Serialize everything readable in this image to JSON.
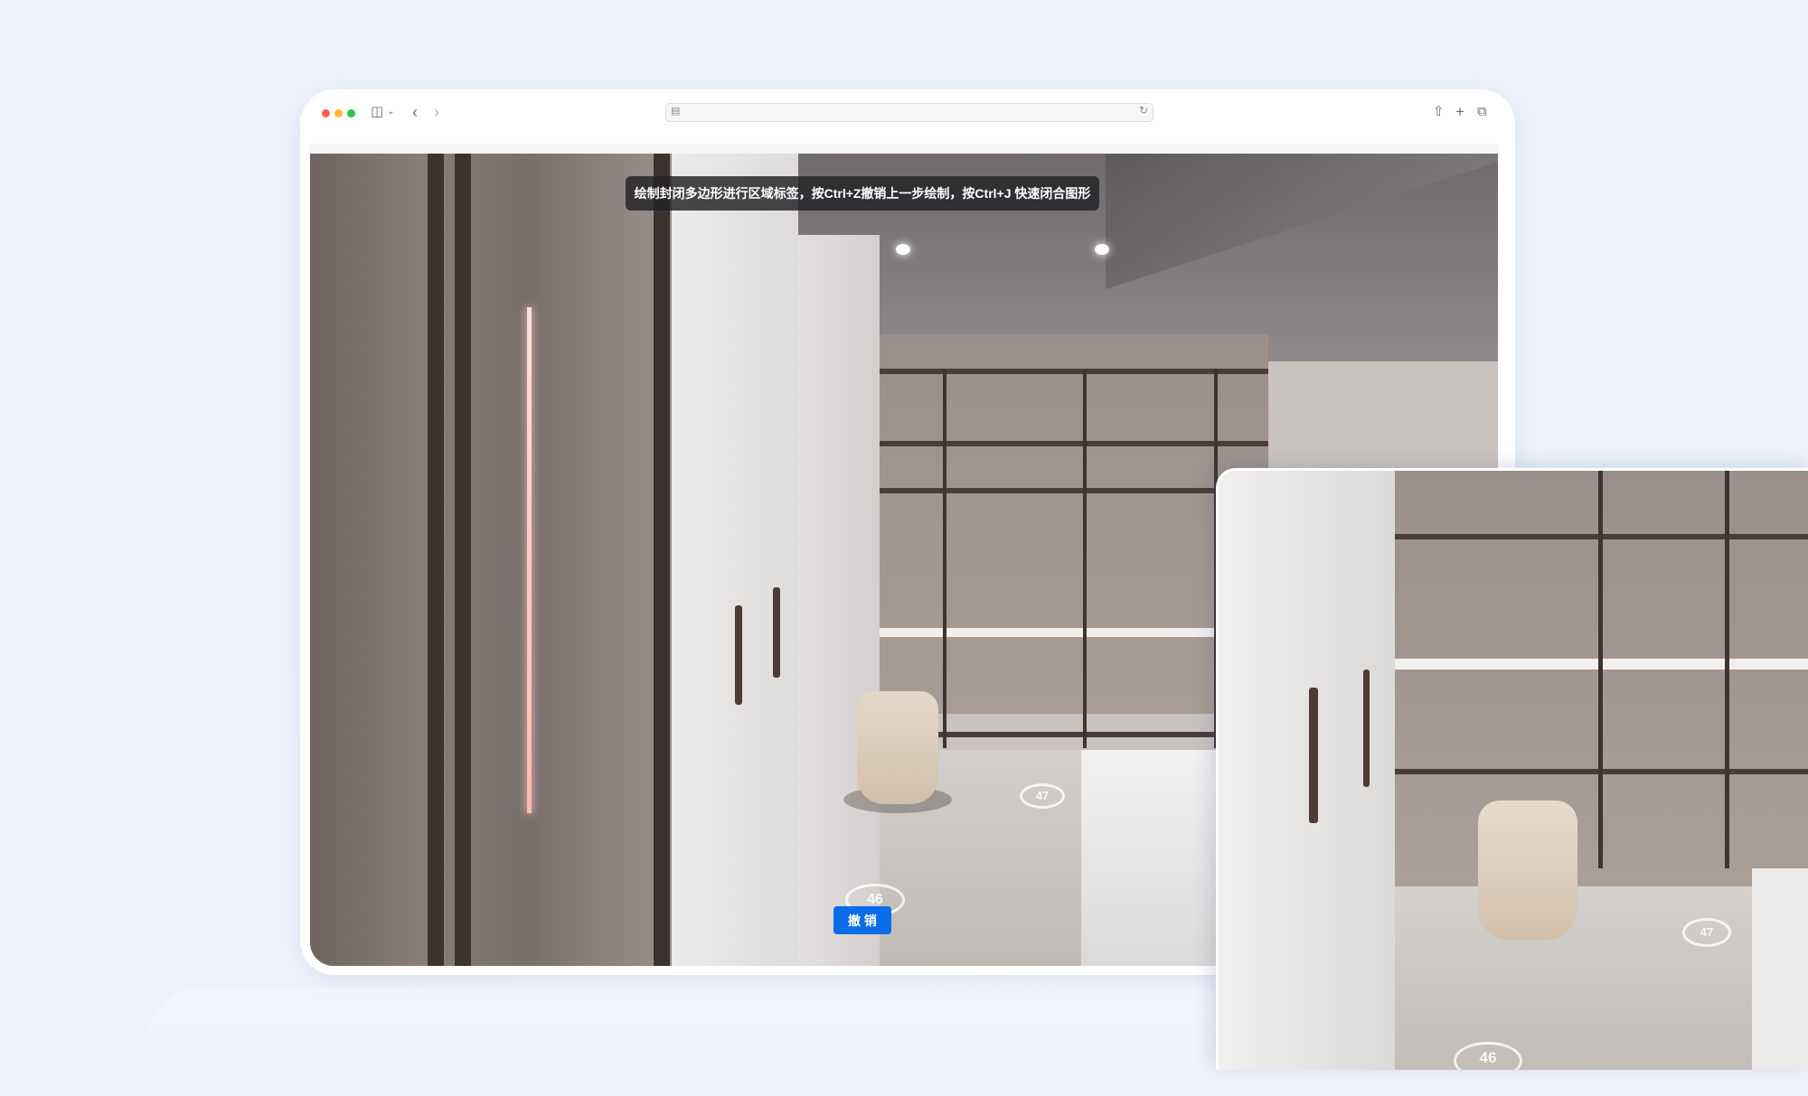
{
  "browser": {
    "traffic_lights": [
      "close",
      "minimize",
      "zoom"
    ],
    "toolbar_icons": [
      "sidebar-icon",
      "chevron-down-icon",
      "back-icon",
      "forward-icon"
    ],
    "url_value": "",
    "right_icons": [
      "share-icon",
      "new-tab-icon",
      "tabs-overview-icon"
    ]
  },
  "scene": {
    "hint_text": "绘制封闭多边形进行区域标签，按Ctrl+Z撤销上一步绘制，按Ctrl+J 快速闭合图形",
    "undo_label": "撤 销",
    "markers": [
      "47",
      "46"
    ]
  },
  "zoom_panel": {
    "markers": [
      "47",
      "46"
    ]
  },
  "colors": {
    "background": "#eef2fb",
    "accent": "#0a6ce8",
    "hint_bg": "#212124"
  }
}
